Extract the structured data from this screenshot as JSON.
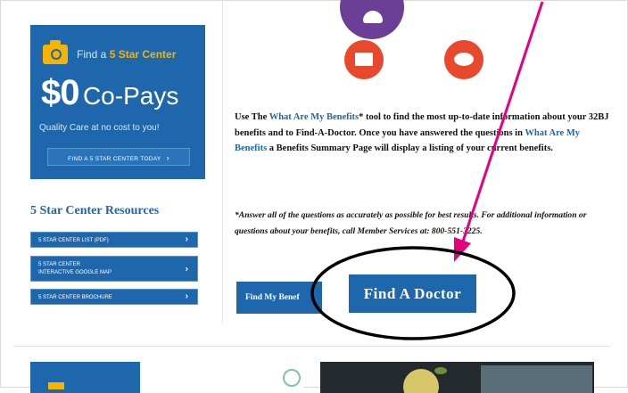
{
  "promo": {
    "find_prefix": "Find a ",
    "find_highlight": "5 Star Center",
    "price": "$0",
    "copays": "Co-Pays",
    "tagline": "Quality Care at no cost to you!",
    "button_label": "FIND A 5 STAR CENTER TODAY",
    "button_arrow": "›"
  },
  "resources": {
    "heading": "5 Star Center Resources",
    "links": [
      {
        "label": "5 STAR CENTER LIST (PDF)"
      },
      {
        "label_line1": "5 STAR CENTER",
        "label_line2": "INTERACTIVE GOOGLE MAP"
      },
      {
        "label": "5 STAR CENTER BROCHURE"
      }
    ],
    "chevron": "›"
  },
  "intro": {
    "t1": "Use The ",
    "link1": "What Are My Benefits",
    "t2": "* tool to find the most up-to-date information about your 32BJ benefits and to ",
    "bold1": "Find-A-Doctor",
    "t3": ". Once you have answered the questions in ",
    "link2": "What Are My Benefits",
    "t4": " a Benefits Summary Page will display a listing of your current benefits."
  },
  "note": "*Answer all of the questions as accurately as possible for best results. For additional information or questions about your benefits, call Member Services at: 800-551-3225.",
  "buttons": {
    "benefits": "Find My Benef",
    "doctor": "Find A Doctor"
  },
  "colors": {
    "brand_blue": "#1f67ad",
    "accent_yellow": "#f6b300",
    "icon_red": "#e8492c",
    "annotation_magenta": "#e6007e"
  },
  "icons": [
    "camera-icon",
    "person-icon",
    "mail-icon",
    "piggy-bank-icon",
    "chevron-right-icon"
  ]
}
